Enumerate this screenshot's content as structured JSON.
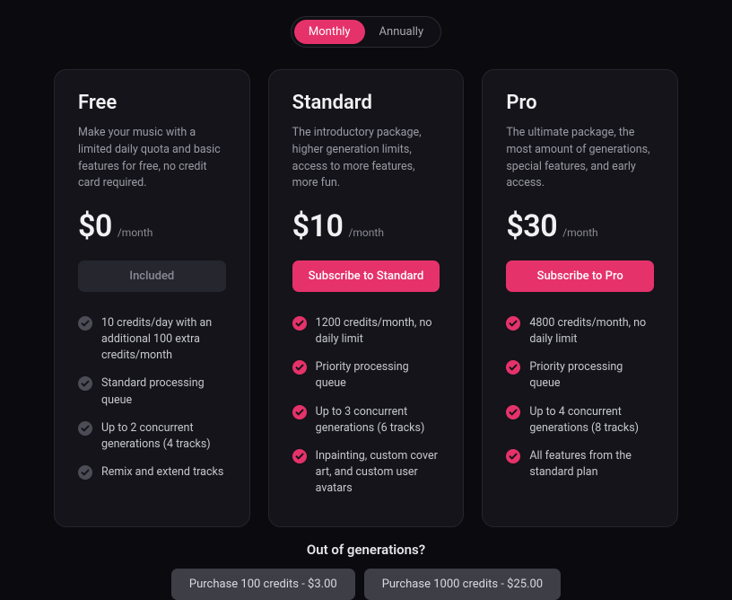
{
  "toggle": {
    "monthly": "Monthly",
    "annually": "Annually"
  },
  "plans": {
    "free": {
      "name": "Free",
      "desc": "Make your music with a limited daily quota and basic features for free, no credit card required.",
      "price": "$0",
      "per": "/month",
      "cta": "Included",
      "features": [
        "10 credits/day with an additional 100 extra credits/month",
        "Standard processing queue",
        "Up to 2 concurrent generations (4 tracks)",
        "Remix and extend tracks"
      ]
    },
    "standard": {
      "name": "Standard",
      "desc": "The introductory package, higher generation limits, access to more features, more fun.",
      "price": "$10",
      "per": "/month",
      "cta": "Subscribe to Standard",
      "features": [
        "1200 credits/month, no daily limit",
        "Priority processing queue",
        "Up to 3 concurrent generations (6 tracks)",
        "Inpainting, custom cover art, and custom user avatars"
      ]
    },
    "pro": {
      "name": "Pro",
      "desc": "The ultimate package, the most amount of generations, special features, and early access.",
      "price": "$30",
      "per": "/month",
      "cta": "Subscribe to Pro",
      "features": [
        "4800 credits/month, no daily limit",
        "Priority processing queue",
        "Up to 4 concurrent generations (8 tracks)",
        "All features from the standard plan"
      ]
    }
  },
  "out": {
    "title": "Out of generations?",
    "btn100": "Purchase 100 credits - $3.00",
    "btn1000": "Purchase 1000 credits - $25.00"
  }
}
